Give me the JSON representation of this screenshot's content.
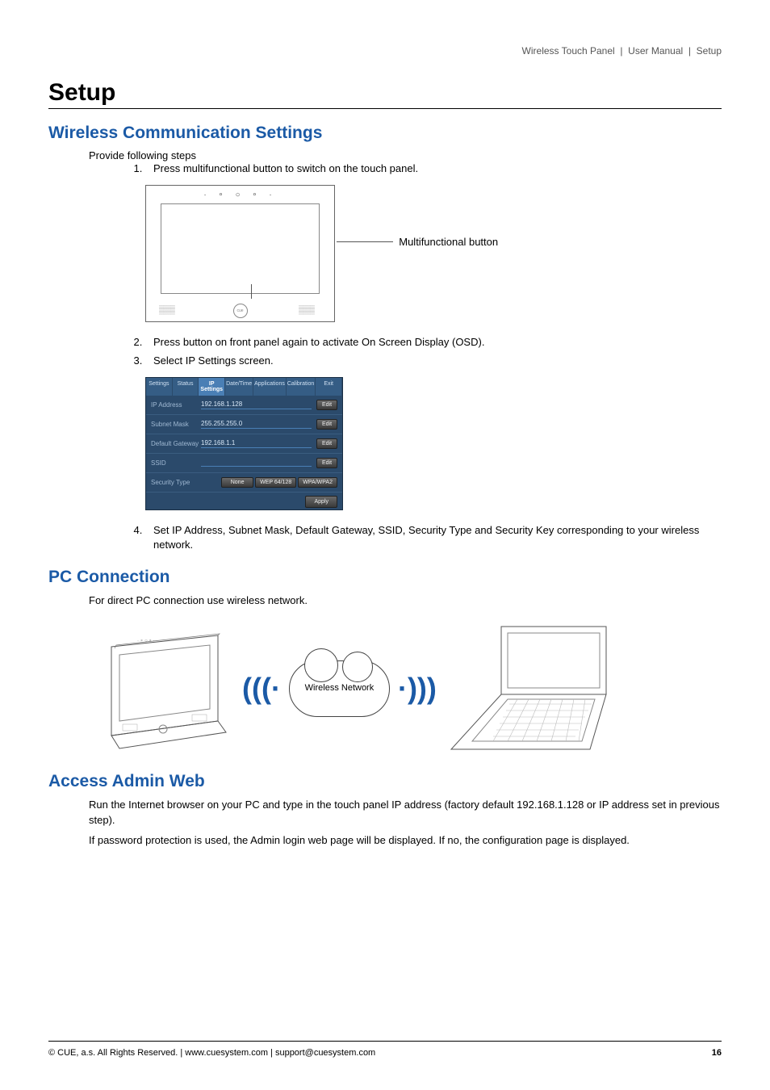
{
  "header": {
    "product": "Wireless Touch Panel",
    "doc": "User Manual",
    "section": "Setup"
  },
  "page_title": "Setup",
  "sections": {
    "wireless": {
      "heading": "Wireless Communication Settings",
      "intro": "Provide following steps",
      "steps": [
        "Press multifunctional button to switch on the touch panel.",
        "Press button on front panel again to activate On Screen Display (OSD).",
        "Select IP Settings screen.",
        "Set IP Address, Subnet Mask, Default Gateway, SSID, Security Type and Security Key corresponding to your wireless network."
      ],
      "callout": "Multifunctional button"
    },
    "pc": {
      "heading": "PC Connection",
      "body": "For direct PC connection use wireless network.",
      "cloud_label": "Wireless Network"
    },
    "admin": {
      "heading": "Access Admin Web",
      "p1": "Run the Internet browser on your PC and type in the touch panel IP address (factory default 192.168.1.128 or IP address set in previous step).",
      "p2": "If password protection is used, the Admin login web page will be displayed. If no, the configuration page is displayed."
    }
  },
  "osd": {
    "tabs": [
      "Settings",
      "Status",
      "IP Settings",
      "Date/Time",
      "Applications",
      "Calibration",
      "Exit"
    ],
    "active_tab": "IP Settings",
    "rows": [
      {
        "label": "IP Address",
        "value": "192.168.1.128",
        "action": "Edit"
      },
      {
        "label": "Subnet Mask",
        "value": "255.255.255.0",
        "action": "Edit"
      },
      {
        "label": "Default Gateway",
        "value": "192.168.1.1",
        "action": "Edit"
      },
      {
        "label": "SSID",
        "value": "",
        "action": "Edit"
      }
    ],
    "security_label": "Security Type",
    "security_opts": [
      "None",
      "WEP 64/128",
      "WPA/WPA2"
    ],
    "apply": "Apply"
  },
  "footer": {
    "left": "© CUE, a.s. All Rights Reserved.  |  www.cuesystem.com  |  support@cuesystem.com",
    "page": "16"
  }
}
